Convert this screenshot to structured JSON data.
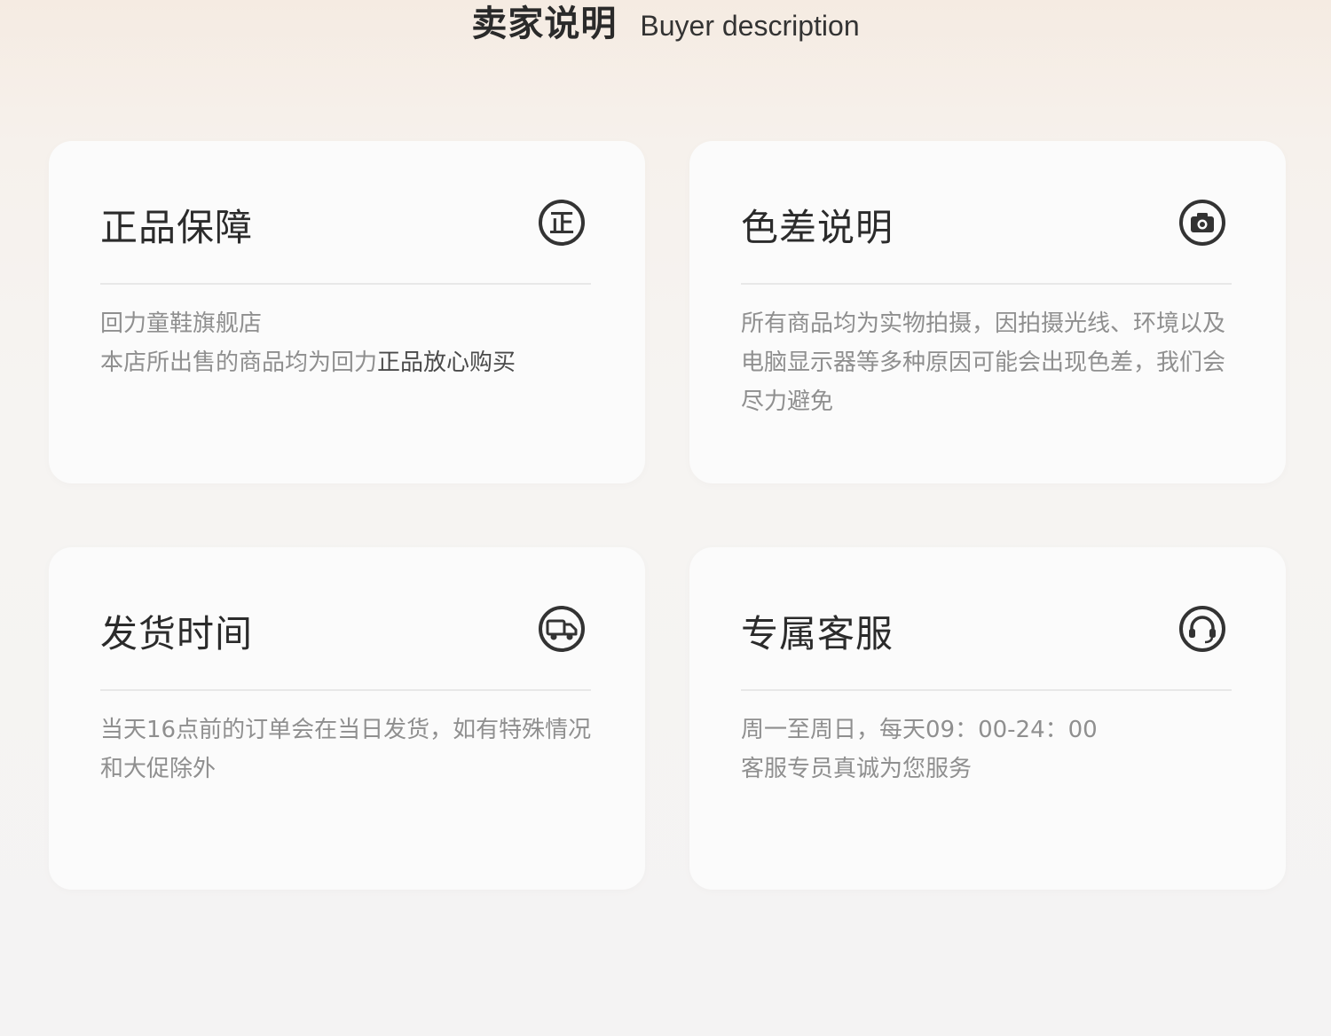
{
  "header": {
    "title_cn": "卖家说明",
    "title_en": "Buyer description"
  },
  "cards": [
    {
      "title": "正品保障",
      "icon": "authentic-badge-icon",
      "icon_char": "正",
      "lines": [
        "回力童鞋旗舰店"
      ],
      "line2_prefix": "本店所出售的商品均为回力",
      "line2_highlight": "正品放心购买"
    },
    {
      "title": "色差说明",
      "icon": "camera-icon",
      "body": "所有商品均为实物拍摄，因拍摄光线、环境以及电脑显示器等多种原因可能会出现色差，我们会尽力避免"
    },
    {
      "title": "发货时间",
      "icon": "delivery-truck-icon",
      "body": "当天16点前的订单会在当日发货，如有特殊情况和大促除外"
    },
    {
      "title": "专属客服",
      "icon": "headset-icon",
      "lines": [
        "周一至周日，每天09：00-24：00",
        "客服专员真诚为您服务"
      ]
    }
  ],
  "colors": {
    "text_dark": "#2b2b2b",
    "text_muted": "#8f8f8f",
    "card_bg": "#fbfbfb",
    "icon_stroke": "#333333"
  }
}
